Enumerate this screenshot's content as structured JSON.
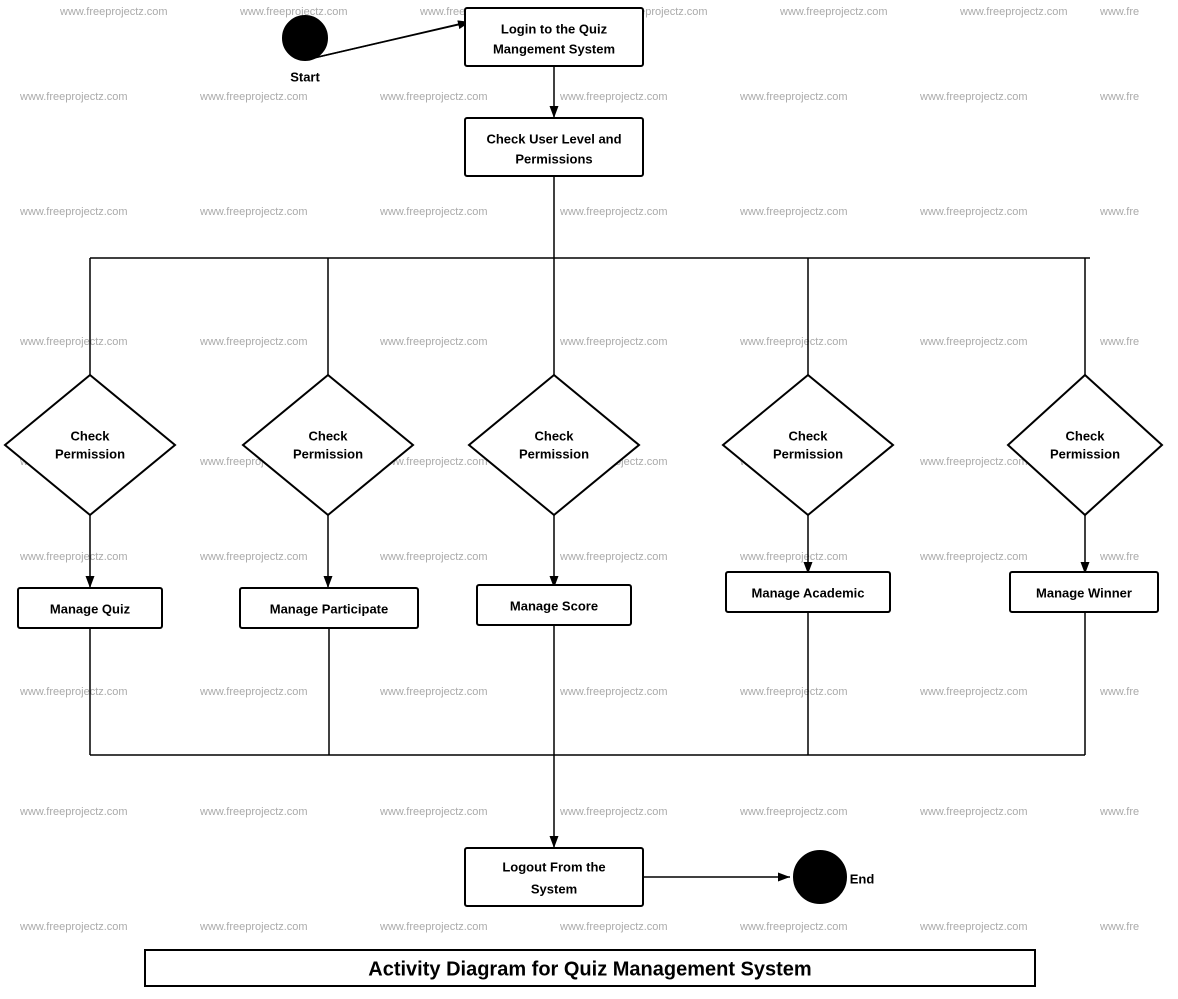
{
  "title": "Activity Diagram for Quiz Management System",
  "watermark": "www.freeprojectz.com",
  "nodes": {
    "start_label": "Start",
    "login": "Login to the Quiz\nMangement System",
    "check_user": "Check User Level and\nPermissions",
    "check_perm1": "Check\nPermission",
    "check_perm2": "Check\nPermission",
    "check_perm3": "Check\nPermission",
    "check_perm4": "Check\nPermission",
    "check_perm5": "Check\nPermission",
    "manage_quiz": "Manage Quiz",
    "manage_participate": "Manage Participate",
    "manage_score": "Manage Score",
    "manage_academic": "Manage Academic",
    "manage_winner": "Manage Winner",
    "logout": "Logout From the\nSystem",
    "end_label": "End"
  }
}
